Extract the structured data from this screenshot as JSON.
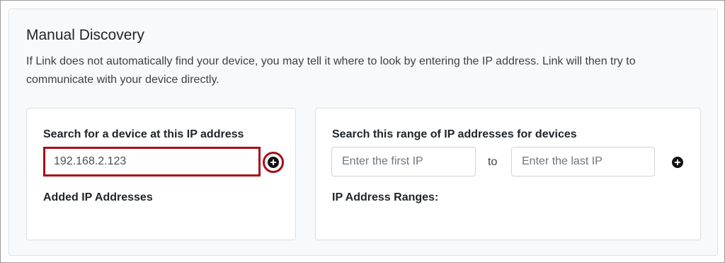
{
  "section": {
    "title": "Manual Discovery",
    "description": "If Link does not automatically find your device, you may tell it where to look by entering the IP address. Link will then try to communicate with your device directly."
  },
  "single_ip": {
    "label": "Search for a device at this IP address",
    "value": "192.168.2.123",
    "add_icon": "plus-circle-icon",
    "added_heading": "Added IP Addresses"
  },
  "ip_range": {
    "label": "Search this range of IP addresses for devices",
    "first_placeholder": "Enter the first IP",
    "separator": "to",
    "last_placeholder": "Enter the last IP",
    "add_icon": "plus-circle-icon",
    "ranges_heading": "IP Address Ranges:"
  },
  "colors": {
    "highlight": "#a8101a",
    "panel_background": "#f8f9fa",
    "card_background": "#ffffff"
  }
}
